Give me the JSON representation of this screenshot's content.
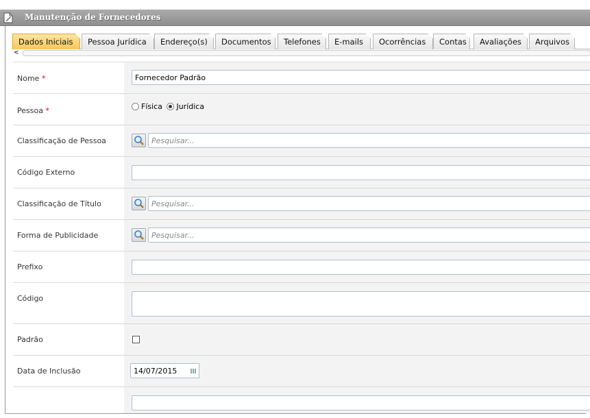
{
  "window": {
    "title": "Manutenção de Fornecedores"
  },
  "tabs": [
    {
      "label": "Dados Iniciais",
      "active": true
    },
    {
      "label": "Pessoa Jurídica",
      "active": false
    },
    {
      "label": "Endereço(s)",
      "active": false
    },
    {
      "label": "Documentos",
      "active": false
    },
    {
      "label": "Telefones",
      "active": false
    },
    {
      "label": "E-mails",
      "active": false
    },
    {
      "label": "Ocorrências",
      "active": false
    },
    {
      "label": "Contas",
      "active": false
    },
    {
      "label": "Avaliações",
      "active": false
    },
    {
      "label": "Arquivos",
      "active": false
    }
  ],
  "scroll": {
    "left_arrow": "<"
  },
  "form": {
    "nome": {
      "label": "Nome",
      "required_mark": "*",
      "value": "Fornecedor Padrão"
    },
    "pessoa": {
      "label": "Pessoa",
      "required_mark": "*",
      "option_fisica": "Física",
      "option_juridica": "Jurídica",
      "selected": "Jurídica"
    },
    "classificacao_pessoa": {
      "label": "Classificação de Pessoa",
      "placeholder": "Pesquisar..."
    },
    "codigo_externo": {
      "label": "Código Externo",
      "value": ""
    },
    "classificacao_titulo": {
      "label": "Classificação de Título",
      "placeholder": "Pesquisar..."
    },
    "forma_publicidade": {
      "label": "Forma de Publicidade",
      "placeholder": "Pesquisar..."
    },
    "prefixo": {
      "label": "Prefixo",
      "value": ""
    },
    "codigo": {
      "label": "Código",
      "value": ""
    },
    "padrao": {
      "label": "Padrão",
      "checked": false
    },
    "data_inclusao": {
      "label": "Data de Inclusão",
      "value": "14/07/2015"
    }
  },
  "icons": {
    "window": "document-edit-icon",
    "search": "magnifier-icon",
    "calendar": "calendar-icon"
  },
  "colors": {
    "active_tab": "#f7c75a",
    "required": "#e00000",
    "input_border": "#a9bfd6"
  }
}
